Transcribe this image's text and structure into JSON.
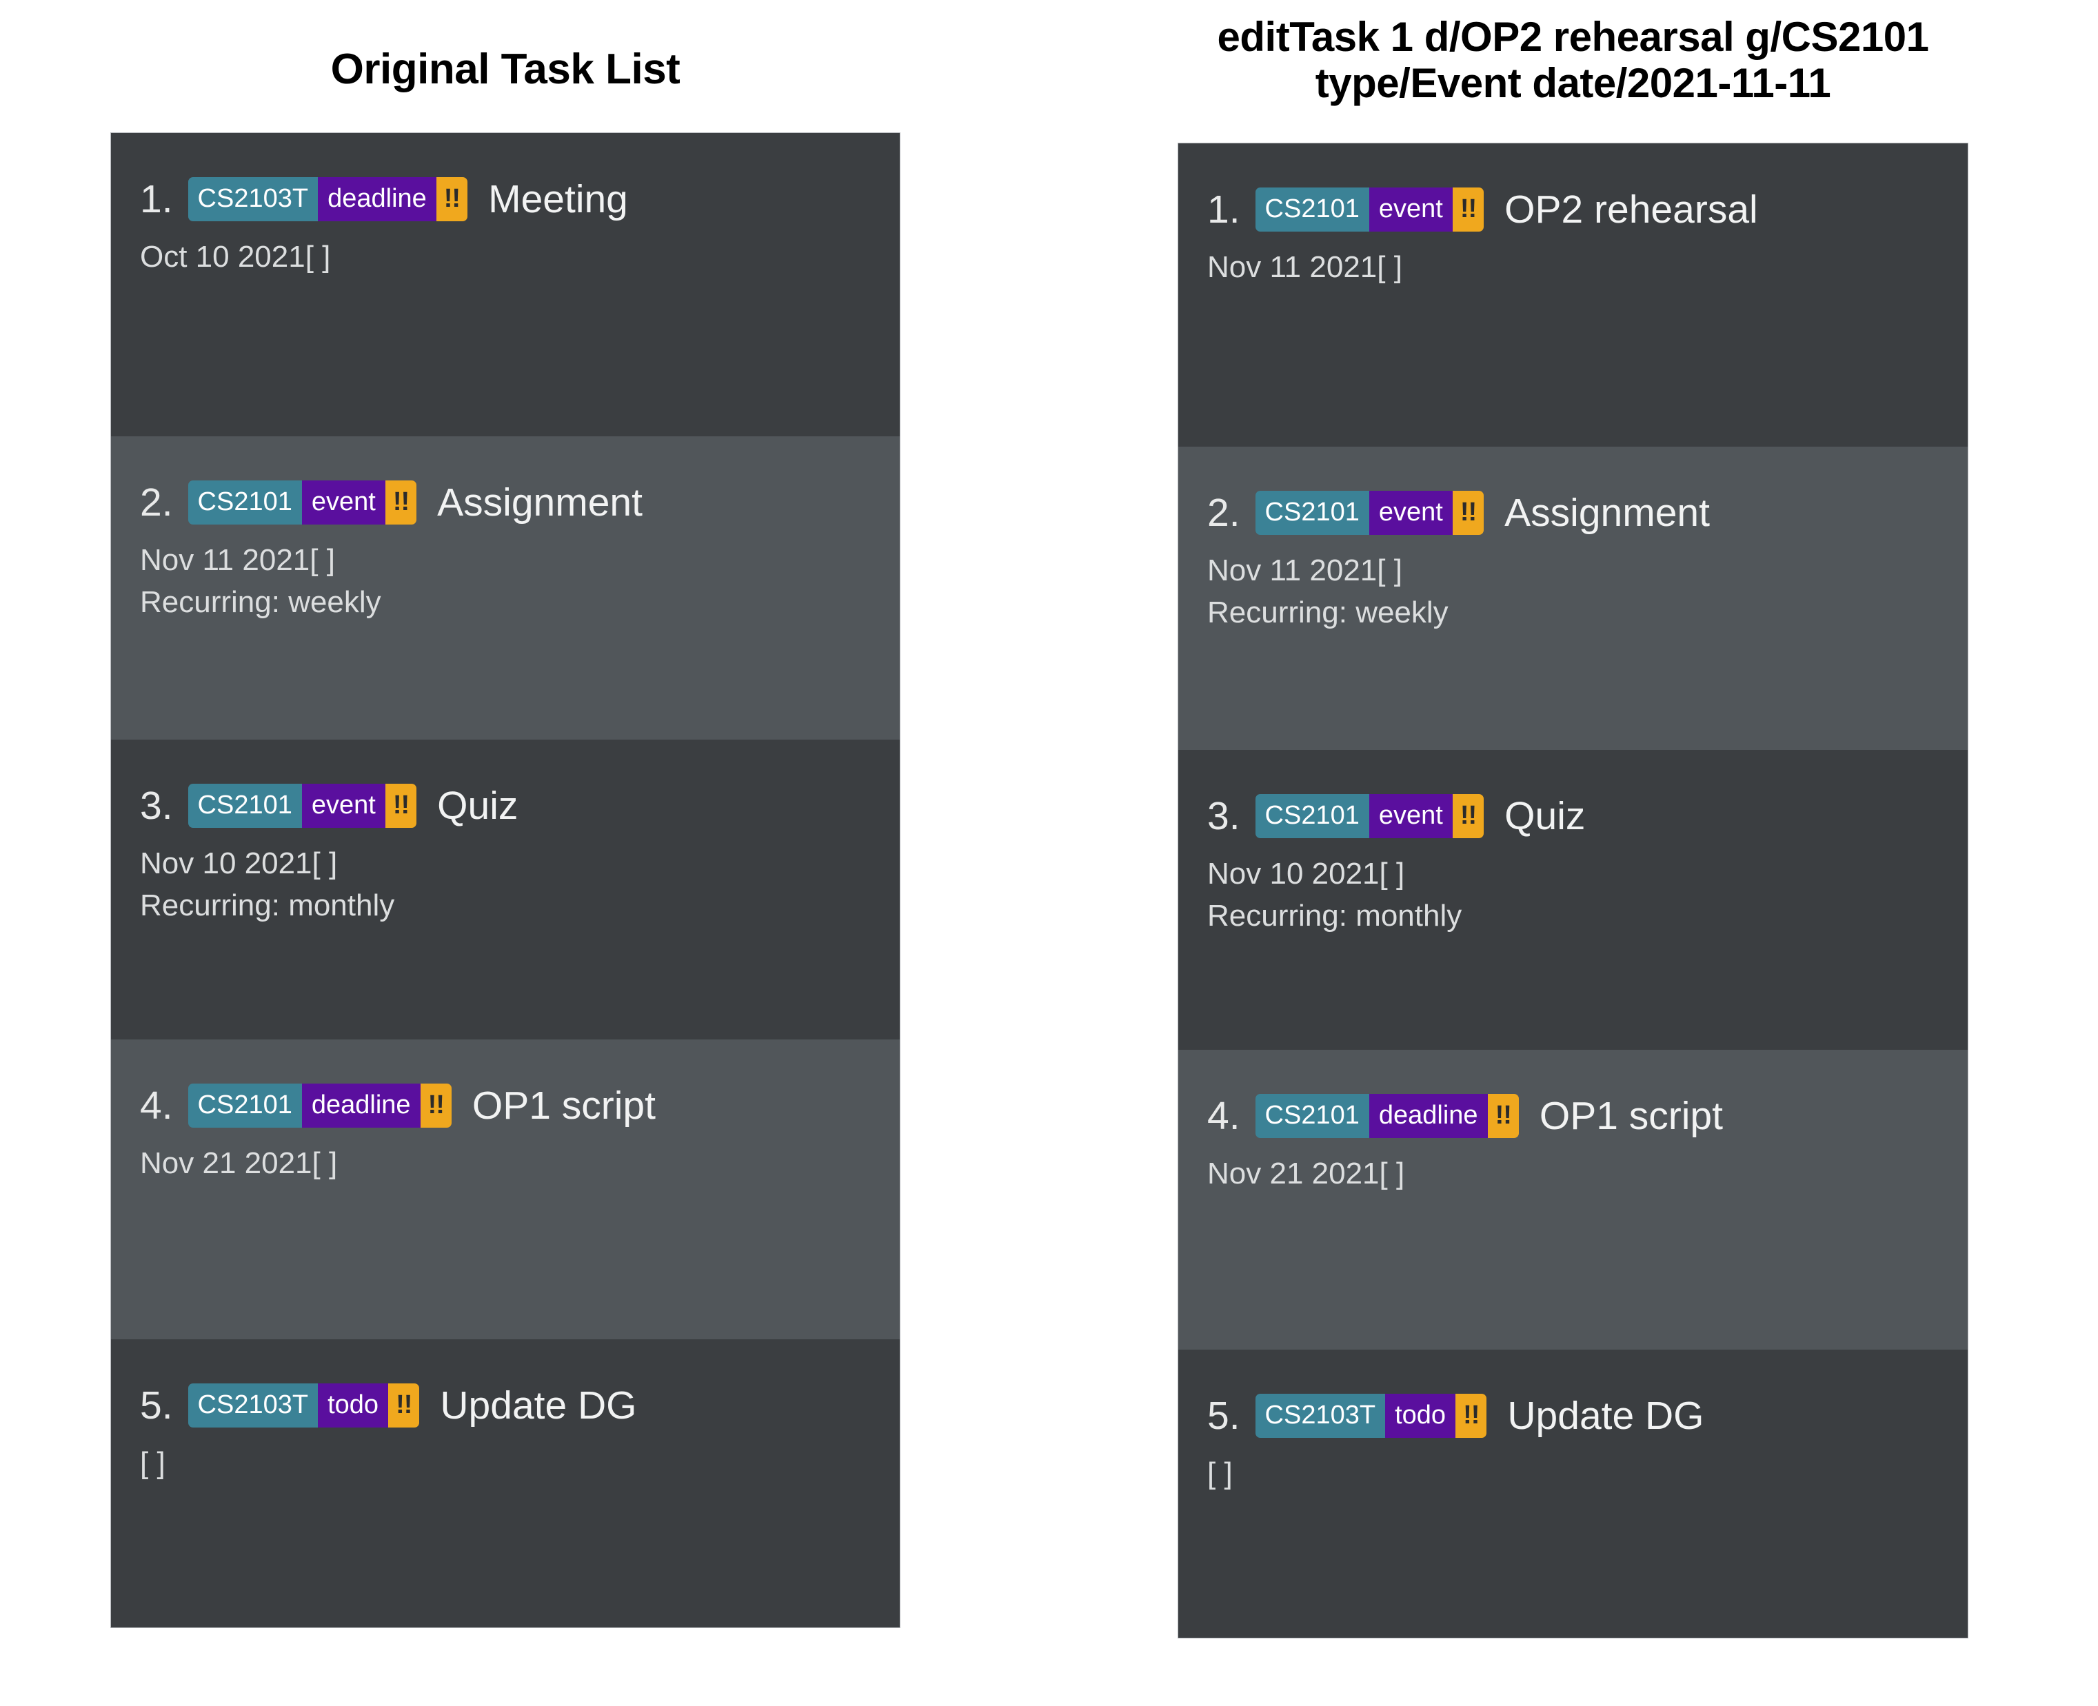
{
  "colors": {
    "page_background": "#ffffff",
    "panel_border": "#b9bcc0",
    "row_dark": "#3b3e41",
    "row_light": "#51565a",
    "tag_group": "#3b8296",
    "tag_type": "#5a0f9e",
    "tag_priority": "#f0a81e",
    "text_primary": "#f2f3f3",
    "text_secondary": "#dcdedf",
    "title_text": "#000000"
  },
  "panels": [
    {
      "id": "original-task-list",
      "title": "Original Task List",
      "tasks": [
        {
          "index": "1.",
          "group": "CS2103T",
          "type": "deadline",
          "priority": "!!",
          "title": "Meeting",
          "date": "Oct 10 2021[ ]",
          "recurring": ""
        },
        {
          "index": "2.",
          "group": "CS2101",
          "type": "event",
          "priority": "!!",
          "title": "Assignment",
          "date": "Nov 11 2021[ ]",
          "recurring": "Recurring: weekly"
        },
        {
          "index": "3.",
          "group": "CS2101",
          "type": "event",
          "priority": "!!",
          "title": "Quiz",
          "date": "Nov 10 2021[ ]",
          "recurring": "Recurring: monthly"
        },
        {
          "index": "4.",
          "group": "CS2101",
          "type": "deadline",
          "priority": "!!",
          "title": "OP1 script",
          "date": "Nov 21 2021[ ]",
          "recurring": ""
        },
        {
          "index": "5.",
          "group": "CS2103T",
          "type": "todo",
          "priority": "!!",
          "title": "Update DG",
          "date": "[ ]",
          "recurring": ""
        }
      ]
    },
    {
      "id": "edited-task-list",
      "title": "editTask 1 d/OP2 rehearsal g/CS2101 type/Event date/2021-11-11",
      "title_line1": "editTask 1 d/OP2 rehearsal g/CS2101",
      "title_line2": "type/Event date/2021-11-11",
      "tasks": [
        {
          "index": "1.",
          "group": "CS2101",
          "type": "event",
          "priority": "!!",
          "title": "OP2 rehearsal",
          "date": "Nov 11 2021[ ]",
          "recurring": ""
        },
        {
          "index": "2.",
          "group": "CS2101",
          "type": "event",
          "priority": "!!",
          "title": "Assignment",
          "date": "Nov 11 2021[ ]",
          "recurring": "Recurring: weekly"
        },
        {
          "index": "3.",
          "group": "CS2101",
          "type": "event",
          "priority": "!!",
          "title": "Quiz",
          "date": "Nov 10 2021[ ]",
          "recurring": "Recurring: monthly"
        },
        {
          "index": "4.",
          "group": "CS2101",
          "type": "deadline",
          "priority": "!!",
          "title": "OP1 script",
          "date": "Nov 21 2021[ ]",
          "recurring": ""
        },
        {
          "index": "5.",
          "group": "CS2103T",
          "type": "todo",
          "priority": "!!",
          "title": "Update DG",
          "date": "[ ]",
          "recurring": ""
        }
      ]
    }
  ]
}
